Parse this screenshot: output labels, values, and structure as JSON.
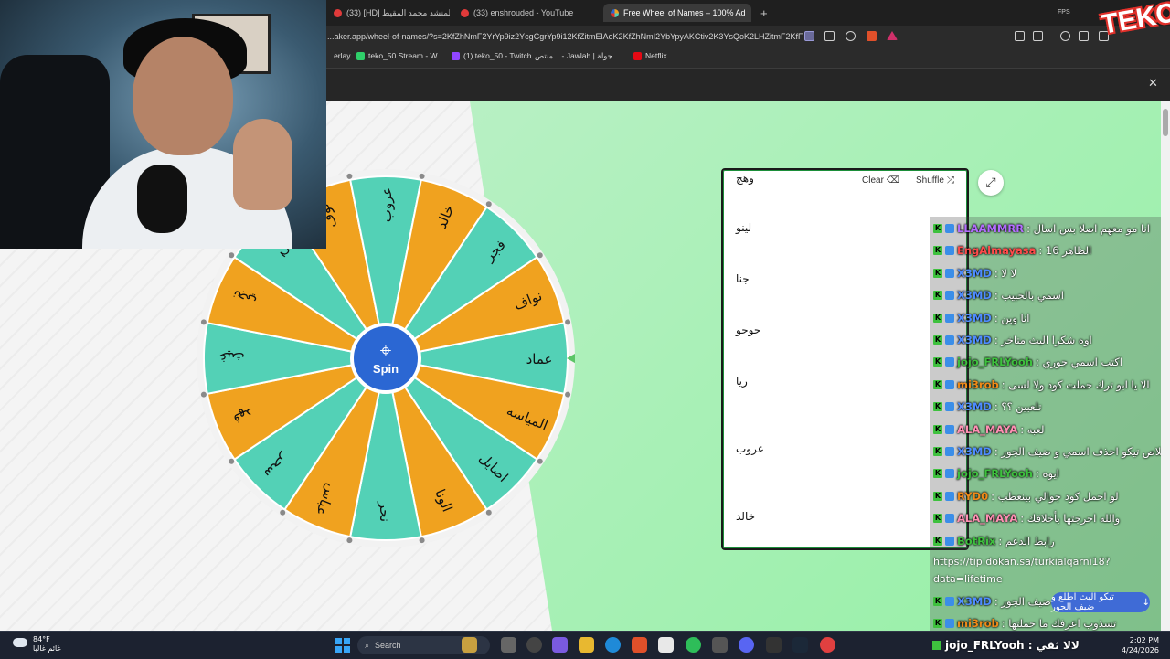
{
  "browser": {
    "tabs": [
      {
        "label": "(33) [HD] عبد الإله للمنشد محمد المقيط"
      },
      {
        "label": "(33) enshrouded - YouTube"
      },
      {
        "label": "Free Wheel of Names – 100% Ad"
      }
    ],
    "new_tab": "+",
    "url": "...aker.app/wheel-of-names/?s=2KfZhNmF2YrYp9iz2YcgCgrYp9i12KfZitmElAoK2KfZhNmI2YbYpyAKCtiv2K3YsQoK2LHZitmF2KfF...",
    "bookmarks": [
      {
        "label": "...erlay..."
      },
      {
        "label": "teko_50 Stream - W..."
      },
      {
        "label": "(1) teko_50 - Twitch"
      },
      {
        "label": "منتص... - Jawlah | جولة"
      },
      {
        "label": "Netflix"
      }
    ],
    "fps_label": "FPS",
    "overlay_logo": "TEKO"
  },
  "wheel": {
    "spin_label": "Spin",
    "segments": [
      "عماد",
      "المياسه",
      "اصايل",
      "الونا",
      "نحر",
      "عباس",
      "سحر",
      "فهد",
      "غيث",
      "نجي",
      "فرح",
      "نوف",
      "عروب",
      "خالد",
      "فجر",
      "نواف"
    ],
    "colors": {
      "teal": "#53d1b6",
      "orange": "#f0a21f",
      "hub": "#2b67d3",
      "pointer": "#5cc466"
    }
  },
  "entries": {
    "clear_label": "Clear",
    "shuffle_label": "Shuffle",
    "items": [
      "وهج",
      "لينو",
      "جنا",
      "جوجو",
      "ريا",
      "عروب",
      "خالد"
    ]
  },
  "chat": {
    "messages": [
      {
        "user": "LLAAMMRR",
        "text": ": انا مو معهم اصلا بس اسال",
        "color": "#b36cff"
      },
      {
        "user": "EngAlmayasa",
        "text": ": الظاهر 16",
        "color": "#ff4a4a"
      },
      {
        "user": "X3MD",
        "text": ": لا لا",
        "color": "#4e8cff"
      },
      {
        "user": "X3MD",
        "text": ": اسمي بالحبيب",
        "color": "#4e8cff"
      },
      {
        "user": "X3MD",
        "text": ": انا وين",
        "color": "#4e8cff"
      },
      {
        "user": "X3MD",
        "text": ": اوه شكرا البث متاخر",
        "color": "#4e8cff"
      },
      {
        "user": "jojo_FRLYooh",
        "text": ": اكتب اسمي جوري",
        "color": "#3ec13e"
      },
      {
        "user": "mi3rob",
        "text": ": الا يا ابو ترك حملت كود ولا لسى",
        "color": "#f08a18"
      },
      {
        "user": "X3MD",
        "text": ": تلعبين ؟؟",
        "color": "#4e8cff"
      },
      {
        "user": "ALA_MAYA",
        "text": ": لعبه",
        "color": "#ff8fb3"
      },
      {
        "user": "X3MD",
        "text": ": خلاص تيكو احذف اسمي و ضيف الجور",
        "color": "#4e8cff"
      },
      {
        "user": "jojo_FRLYooh",
        "text": ": ايوه",
        "color": "#3ec13e"
      },
      {
        "user": "RYD0",
        "text": ": لو احمل كود جوالي بينعطب",
        "color": "#f08a18"
      },
      {
        "user": "ALA_MAYA",
        "text": ": والله احرجتها بأخلاقك",
        "color": "#ff8fb3"
      },
      {
        "user": "BotRix",
        "text": ": رابط الدعم",
        "color": "#3ec13e"
      }
    ],
    "link_text": "https://tip.dokan.sa/turkialqarni18?data=lifetime",
    "after_messages": [
      {
        "user": "X3MD",
        "text": ": تيكو البث اطلع و ضيف الجور",
        "color": "#4e8cff"
      },
      {
        "user": "mi3rob",
        "text": ": تسذوب اعرفك ما حملتها",
        "color": "#f08a18"
      }
    ],
    "scroll_pill": "تيكو البث اطلع و ضيف الجور"
  },
  "taskbar": {
    "weather_temp": "84°F",
    "weather_desc": "غائم غالبا",
    "search_label": "Search",
    "time": "2:02 PM",
    "date": "4/24/2026",
    "tray_user": "jojo_FRLYooh :",
    "tray_text": "لالا ثقي"
  }
}
